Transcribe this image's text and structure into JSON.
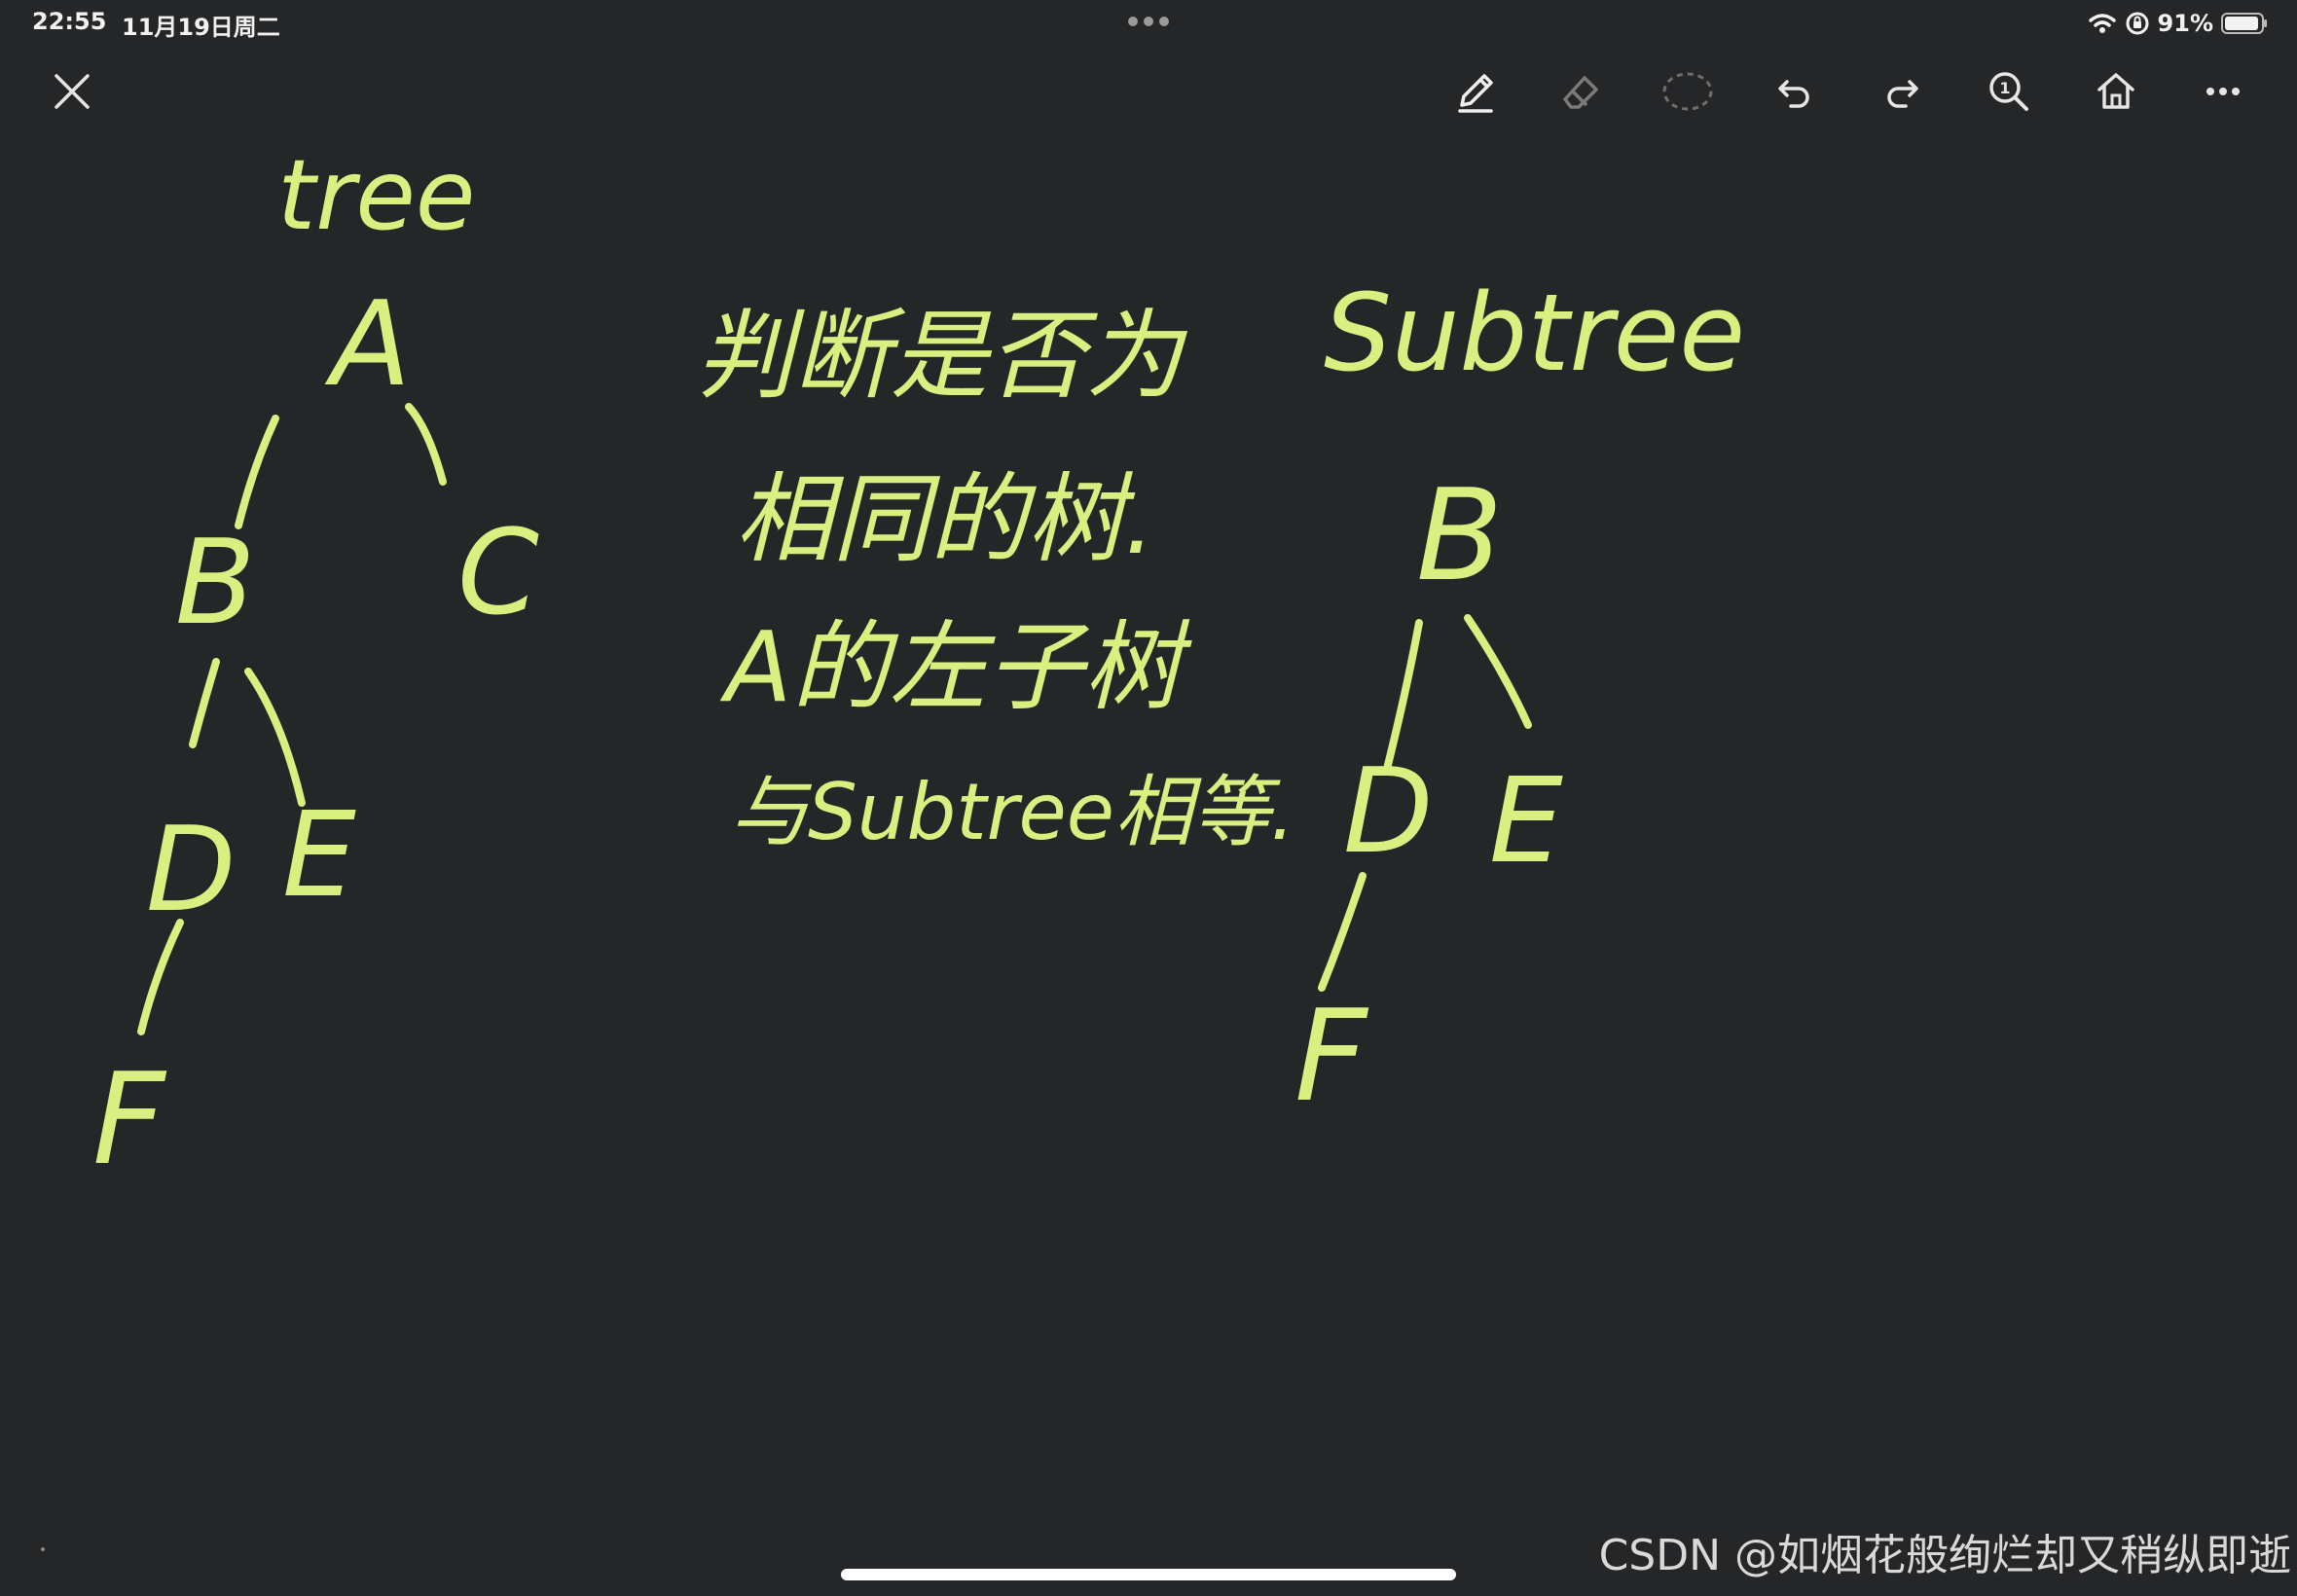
{
  "status_bar": {
    "time": "22:55",
    "date": "11月19日周二",
    "battery_percent": "91%",
    "icons": [
      "wifi-icon",
      "orientation-lock-icon",
      "battery-icon"
    ]
  },
  "toolbar": {
    "close_icon": "close-icon",
    "tools": [
      {
        "name": "pen-tool",
        "icon": "pen-icon",
        "selected": true
      },
      {
        "name": "eraser-tool",
        "icon": "eraser-icon"
      },
      {
        "name": "lasso-tool",
        "icon": "lasso-icon"
      },
      {
        "name": "undo",
        "icon": "undo-icon"
      },
      {
        "name": "redo",
        "icon": "redo-icon"
      },
      {
        "name": "zoom",
        "icon": "zoom-icon",
        "badge": "1"
      },
      {
        "name": "home",
        "icon": "home-icon"
      },
      {
        "name": "more",
        "icon": "more-icon"
      }
    ]
  },
  "canvas": {
    "ink_color": "#d8f080",
    "background": "#252628",
    "left_tree": {
      "label": "tree",
      "nodes": [
        "A",
        "B",
        "C",
        "D",
        "E",
        "F"
      ]
    },
    "right_tree": {
      "label": "Subtree",
      "nodes": [
        "B",
        "D",
        "E",
        "F"
      ]
    },
    "notes": [
      "判断是否为",
      "相同的树.",
      "A的左子树",
      "与Subtree相等."
    ]
  },
  "watermark": "CSDN @如烟花般绚烂却又稍纵即逝"
}
